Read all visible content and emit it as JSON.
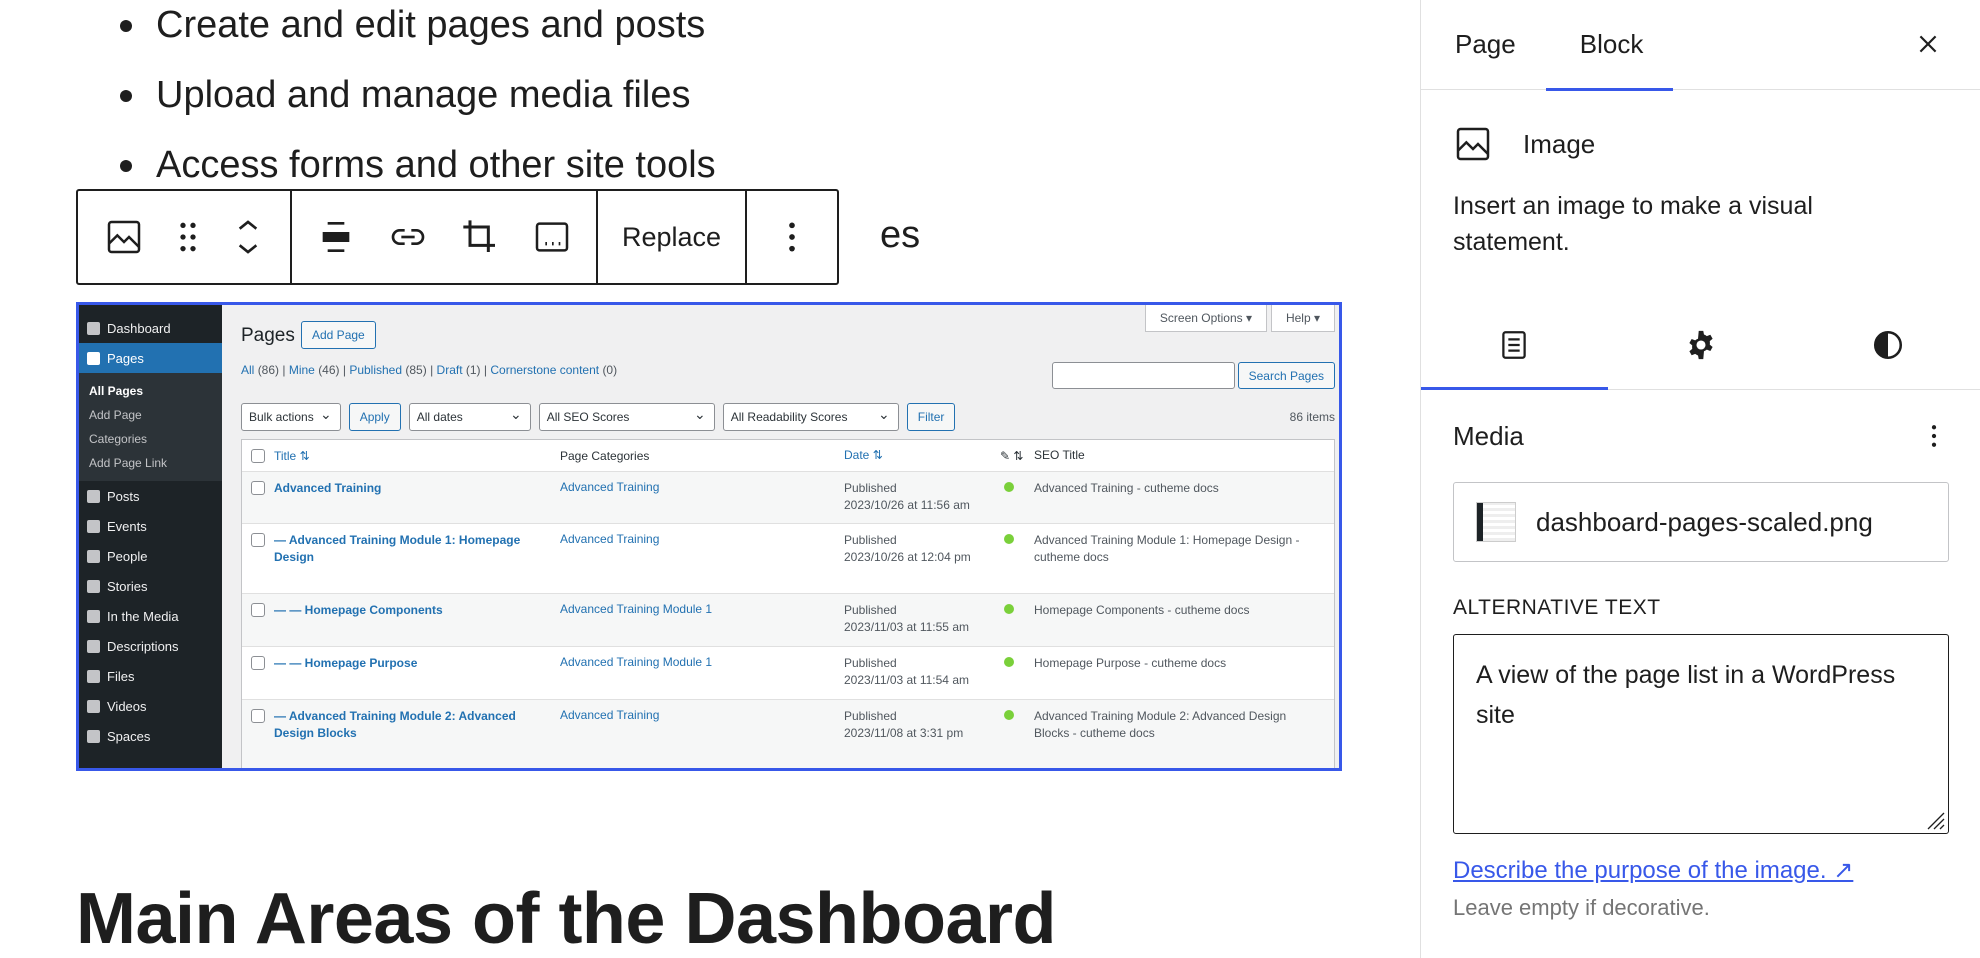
{
  "content": {
    "bullets": [
      "Create and edit pages and posts",
      "Upload and manage media files",
      "Access forms and other site tools",
      "es"
    ],
    "heading": "Main Areas of the Dashboard"
  },
  "toolbar": {
    "replace_label": "Replace"
  },
  "screenshot": {
    "menu": [
      {
        "label": "Dashboard",
        "icon": "dashboard-icon"
      },
      {
        "label": "Pages",
        "icon": "pages-icon",
        "active": true
      },
      {
        "label": "Posts",
        "icon": "pin-icon"
      },
      {
        "label": "Events",
        "icon": "calendar-icon"
      },
      {
        "label": "People",
        "icon": "person-icon"
      },
      {
        "label": "Stories",
        "icon": "grid-icon"
      },
      {
        "label": "In the Media",
        "icon": "megaphone-icon"
      },
      {
        "label": "Descriptions",
        "icon": "document-icon"
      },
      {
        "label": "Files",
        "icon": "document-icon"
      },
      {
        "label": "Videos",
        "icon": "video-icon"
      },
      {
        "label": "Spaces",
        "icon": "person-icon"
      }
    ],
    "submenu": [
      "All Pages",
      "Add Page",
      "Categories",
      "Add Page Link"
    ],
    "title": "Pages",
    "add_page": "Add Page",
    "screen_options": "Screen Options ▾",
    "help": "Help ▾",
    "views": [
      {
        "label": "All",
        "count": "(86)"
      },
      {
        "label": "Mine",
        "count": "(46)"
      },
      {
        "label": "Published",
        "count": "(85)"
      },
      {
        "label": "Draft",
        "count": "(1)"
      },
      {
        "label": "Cornerstone content",
        "count": "(0)"
      }
    ],
    "search_button": "Search Pages",
    "filters": {
      "bulk": "Bulk actions",
      "apply": "Apply",
      "dates": "All dates",
      "seo": "All SEO Scores",
      "readability": "All Readability Scores",
      "filter": "Filter"
    },
    "items_count": "86 items",
    "columns": [
      "Title",
      "Page Categories",
      "Date",
      "SEO Title"
    ],
    "rows": [
      {
        "title": "Advanced Training",
        "category": "Advanced Training",
        "status": "Published",
        "date": "2023/10/26 at 11:56 am",
        "seo": "Advanced Training - cutheme docs"
      },
      {
        "title": "— Advanced Training Module 1: Homepage Design",
        "category": "Advanced Training",
        "status": "Published",
        "date": "2023/10/26 at 12:04 pm",
        "seo": "Advanced Training Module 1: Homepage Design - cutheme docs"
      },
      {
        "title": "— — Homepage Components",
        "category": "Advanced Training Module 1",
        "status": "Published",
        "date": "2023/11/03 at 11:55 am",
        "seo": "Homepage Components - cutheme docs"
      },
      {
        "title": "— — Homepage Purpose",
        "category": "Advanced Training Module 1",
        "status": "Published",
        "date": "2023/11/03 at 11:54 am",
        "seo": "Homepage Purpose - cutheme docs"
      },
      {
        "title": "— Advanced Training Module 2: Advanced Design Blocks",
        "category": "Advanced Training",
        "status": "Published",
        "date": "2023/11/08 at 3:31 pm",
        "seo": "Advanced Training Module 2: Advanced Design Blocks - cutheme docs"
      }
    ]
  },
  "sidebar": {
    "tabs": {
      "page": "Page",
      "block": "Block"
    },
    "block_name": "Image",
    "block_desc": "Insert an image to make a visual statement.",
    "panel_title": "Media",
    "media_filename": "dashboard-pages-scaled.png",
    "alt_label": "ALTERNATIVE TEXT",
    "alt_text": "A view of the page list in a WordPress site",
    "describe_link": "Describe the purpose of the image. ↗",
    "hint": "Leave empty if decorative."
  },
  "colors": {
    "accent": "#3858e9",
    "wp_admin_bar": "#1d2327",
    "wp_blue": "#2271b1",
    "seo_good": "#7ad03a"
  }
}
